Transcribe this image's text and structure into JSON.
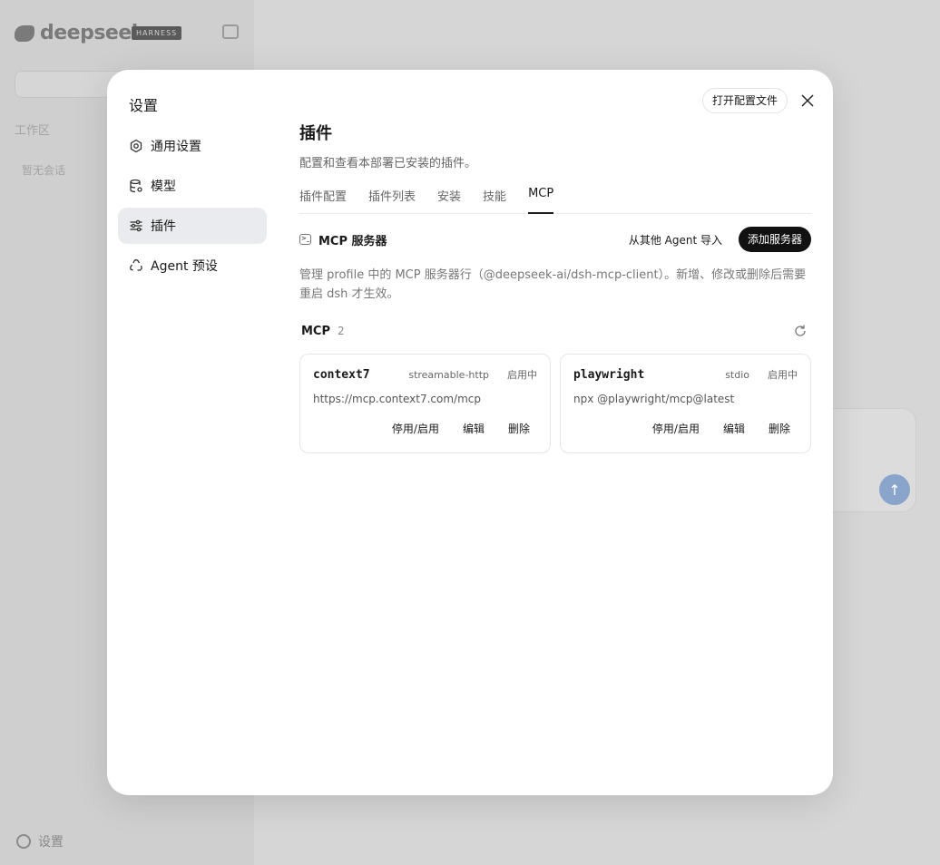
{
  "background": {
    "logo_text": "deepseek",
    "badge": "HARNESS",
    "workspace_label": "工作区",
    "empty_chats": "暂无会话",
    "settings_label": "设置"
  },
  "modal": {
    "title": "设置",
    "open_config_button": "打开配置文件",
    "nav": [
      {
        "label": "通用设置",
        "icon": "gear-icon"
      },
      {
        "label": "模型",
        "icon": "database-icon"
      },
      {
        "label": "插件",
        "icon": "sliders-icon"
      },
      {
        "label": "Agent 预设",
        "icon": "recycle-icon"
      }
    ],
    "active_nav": "插件"
  },
  "content": {
    "title": "插件",
    "subtitle": "配置和查看本部署已安装的插件。",
    "tabs": [
      "插件配置",
      "插件列表",
      "安装",
      "技能",
      "MCP"
    ],
    "active_tab": "MCP",
    "section_title": "MCP 服务器",
    "import_button": "从其他 Agent 导入",
    "add_button": "添加服务器",
    "description": "管理 profile 中的 MCP 服务器行（@deepseek-ai/dsh-mcp-client）。新增、修改或删除后需要重启 dsh 才生效。",
    "mcp_label": "MCP",
    "mcp_count": "2",
    "servers": [
      {
        "name": "context7",
        "type": "streamable-http",
        "status": "启用中",
        "url": "https://mcp.context7.com/mcp",
        "actions": [
          "停用/启用",
          "编辑",
          "删除"
        ]
      },
      {
        "name": "playwright",
        "type": "stdio",
        "status": "启用中",
        "url": "npx @playwright/mcp@latest",
        "actions": [
          "停用/启用",
          "编辑",
          "删除"
        ]
      }
    ]
  },
  "colors": {
    "accent": "#111111",
    "active_nav_bg": "#e9ebee",
    "send_button": "#8aa5cc"
  }
}
